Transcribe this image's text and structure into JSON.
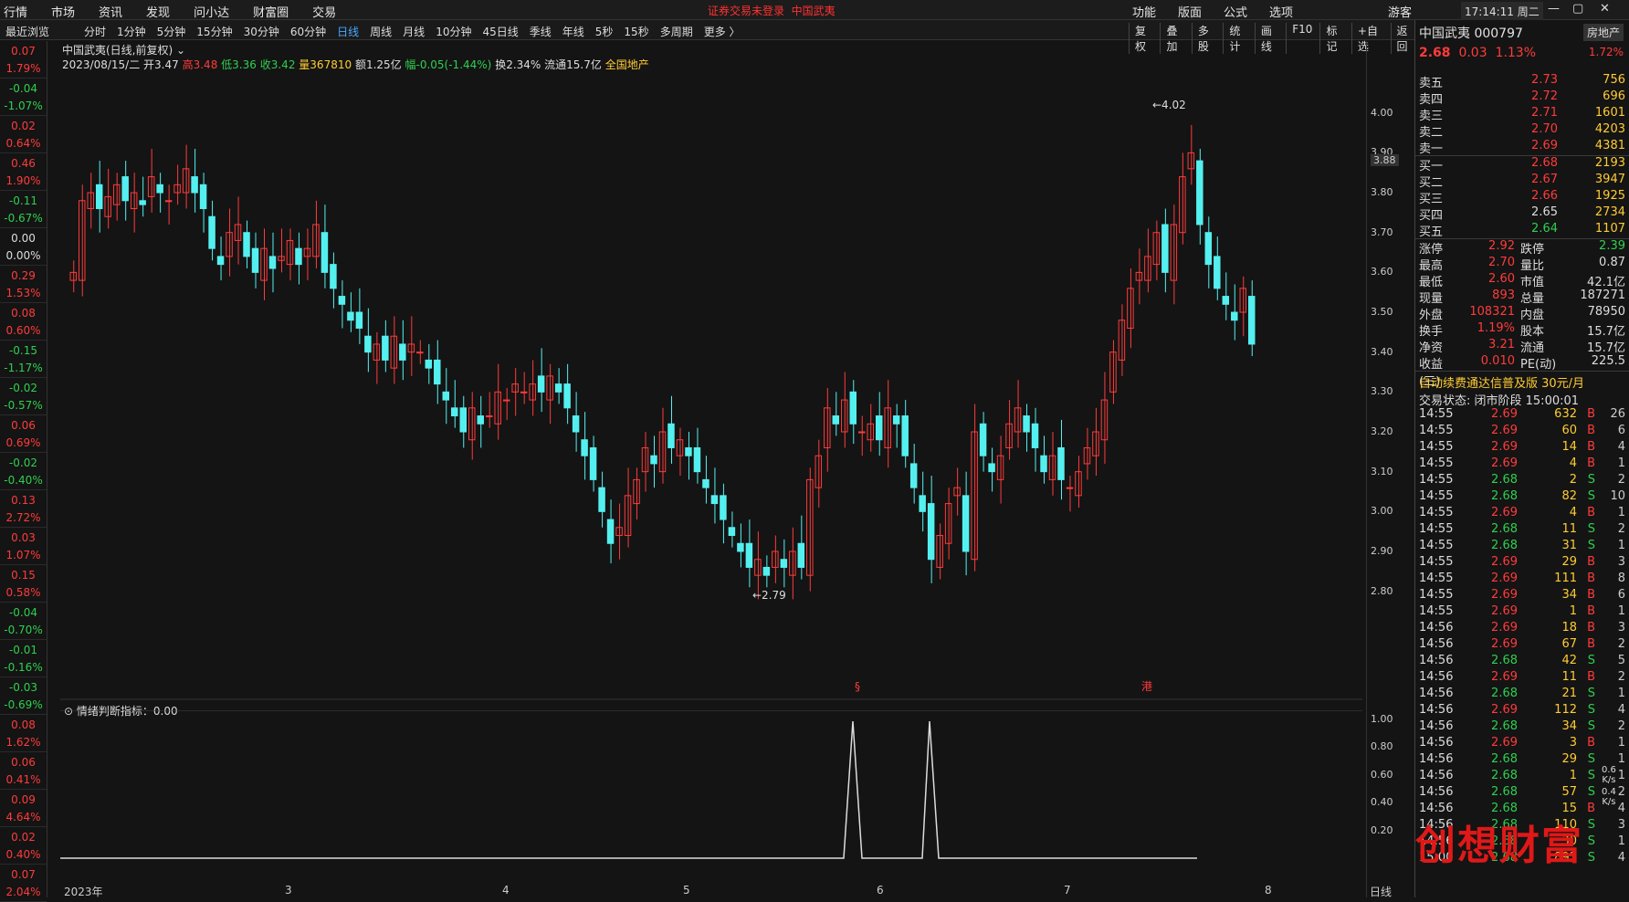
{
  "top": {
    "menu": [
      "行情",
      "市场",
      "资讯",
      "发现",
      "问小达",
      "财富圈",
      "交易"
    ],
    "warning": "证券交易未登录",
    "warning_name": "中国武夷",
    "rmenu": [
      "功能",
      "版面",
      "公式",
      "选项"
    ],
    "guest": "游客",
    "clock": "17:14:11 周二"
  },
  "bar2": {
    "recent": "最近浏览",
    "periods": [
      "分时",
      "1分钟",
      "5分钟",
      "15分钟",
      "30分钟",
      "60分钟",
      "日线",
      "周线",
      "月线",
      "10分钟",
      "45日线",
      "季线",
      "年线",
      "5秒",
      "15秒",
      "多周期",
      "更多 〉"
    ],
    "tools": [
      "复权",
      "叠加",
      "多股",
      "统计",
      "画线",
      "F10",
      "标记",
      "+自选",
      "返回"
    ]
  },
  "left_list": [
    [
      "0.07",
      "1.79%",
      "up"
    ],
    [
      "-0.04",
      "-1.07%",
      "dn"
    ],
    [
      "0.02",
      "0.64%",
      "up"
    ],
    [
      "0.46",
      "1.90%",
      "up"
    ],
    [
      "-0.11",
      "-0.67%",
      "dn"
    ],
    [
      "0.00",
      "0.00%",
      "fl"
    ],
    [
      "0.29",
      "1.53%",
      "up"
    ],
    [
      "0.08",
      "0.60%",
      "up"
    ],
    [
      "-0.15",
      "-1.17%",
      "dn"
    ],
    [
      "-0.02",
      "-0.57%",
      "dn"
    ],
    [
      "0.06",
      "0.69%",
      "up"
    ],
    [
      "-0.02",
      "-0.40%",
      "dn"
    ],
    [
      "0.13",
      "2.72%",
      "up"
    ],
    [
      "0.03",
      "1.07%",
      "up"
    ],
    [
      "0.15",
      "0.58%",
      "up"
    ],
    [
      "-0.04",
      "-0.70%",
      "dn"
    ],
    [
      "-0.01",
      "-0.16%",
      "dn"
    ],
    [
      "-0.03",
      "-0.69%",
      "dn"
    ],
    [
      "0.08",
      "1.62%",
      "up"
    ],
    [
      "0.06",
      "0.41%",
      "up"
    ],
    [
      "0.09",
      "4.64%",
      "up"
    ],
    [
      "0.02",
      "0.40%",
      "up"
    ],
    [
      "0.07",
      "2.04%",
      "up"
    ]
  ],
  "chart": {
    "title": "中国武夷(日线,前复权)",
    "date": "2023/08/15/二",
    "open": "开3.47",
    "high": "高3.48",
    "low": "低3.36",
    "close": "收3.42",
    "vol": "量367810",
    "amt": "额1.25亿",
    "chg": "幅-0.05(-1.44%)",
    "turn": "换2.34%",
    "float": "流通15.7亿",
    "sector": "全国地产",
    "hi_label": "4.02",
    "lo_label": "2.79",
    "price_tag": "3.88",
    "ind_title": "情绪判断指标：0.00",
    "xlabels": [
      "2023年",
      "3",
      "4",
      "5",
      "6",
      "7",
      "8"
    ],
    "dayline": "日线",
    "marker1": "§",
    "marker2": "港"
  },
  "yticks": [
    "4.00",
    "3.90",
    "3.80",
    "3.70",
    "3.60",
    "3.50",
    "3.40",
    "3.30",
    "3.20",
    "3.10",
    "3.00",
    "2.90",
    "2.80"
  ],
  "ind_ticks": [
    "1.00",
    "0.80",
    "0.60",
    "0.40",
    "0.20"
  ],
  "quote": {
    "name": "中国武夷",
    "code": "000797",
    "price": "2.68",
    "chg": "0.03",
    "pct": "1.13%",
    "sector": "房地产",
    "sector_pct": "1.72%"
  },
  "asks": [
    [
      "卖五",
      "2.73",
      "756"
    ],
    [
      "卖四",
      "2.72",
      "696"
    ],
    [
      "卖三",
      "2.71",
      "1601"
    ],
    [
      "卖二",
      "2.70",
      "4203"
    ],
    [
      "卖一",
      "2.69",
      "4381"
    ]
  ],
  "bids": [
    [
      "买一",
      "2.68",
      "2193"
    ],
    [
      "买二",
      "2.67",
      "3947"
    ],
    [
      "买三",
      "2.66",
      "1925"
    ],
    [
      "买四",
      "2.65",
      "2734"
    ],
    [
      "买五",
      "2.64",
      "1107"
    ]
  ],
  "stats": [
    [
      "涨停",
      "2.92",
      "跌停",
      "2.39"
    ],
    [
      "最高",
      "2.70",
      "量比",
      "0.87"
    ],
    [
      "最低",
      "2.60",
      "市值",
      "42.1亿"
    ],
    [
      "现量",
      "893",
      "总量",
      "187271"
    ],
    [
      "外盘",
      "108321",
      "内盘",
      "78950"
    ],
    [
      "换手",
      "1.19%",
      "股本",
      "15.7亿"
    ],
    [
      "净资",
      "3.21",
      "流通",
      "15.7亿"
    ],
    [
      "收益(三)",
      "0.010",
      "PE(动)",
      "225.5"
    ]
  ],
  "promo": "自动续费通达信普及版  30元/月",
  "trade_state": "交易状态: 闭市阶段 15:00:01",
  "ticks": [
    [
      "14:55",
      "2.69",
      "632",
      "B",
      "26"
    ],
    [
      "14:55",
      "2.69",
      "60",
      "B",
      "6"
    ],
    [
      "14:55",
      "2.69",
      "14",
      "B",
      "4"
    ],
    [
      "14:55",
      "2.69",
      "4",
      "B",
      "1"
    ],
    [
      "14:55",
      "2.68",
      "2",
      "S",
      "2"
    ],
    [
      "14:55",
      "2.68",
      "82",
      "S",
      "10"
    ],
    [
      "14:55",
      "2.69",
      "4",
      "B",
      "1"
    ],
    [
      "14:55",
      "2.68",
      "11",
      "S",
      "2"
    ],
    [
      "14:55",
      "2.68",
      "31",
      "S",
      "1"
    ],
    [
      "14:55",
      "2.69",
      "29",
      "B",
      "3"
    ],
    [
      "14:55",
      "2.69",
      "111",
      "B",
      "8"
    ],
    [
      "14:55",
      "2.69",
      "34",
      "B",
      "6"
    ],
    [
      "14:55",
      "2.69",
      "1",
      "B",
      "1"
    ],
    [
      "14:56",
      "2.69",
      "18",
      "B",
      "3"
    ],
    [
      "14:56",
      "2.69",
      "67",
      "B",
      "2"
    ],
    [
      "14:56",
      "2.68",
      "42",
      "S",
      "5"
    ],
    [
      "14:56",
      "2.69",
      "11",
      "B",
      "2"
    ],
    [
      "14:56",
      "2.68",
      "21",
      "S",
      "1"
    ],
    [
      "14:56",
      "2.69",
      "112",
      "S",
      "4"
    ],
    [
      "14:56",
      "2.68",
      "34",
      "S",
      "2"
    ],
    [
      "14:56",
      "2.69",
      "3",
      "B",
      "1"
    ],
    [
      "14:56",
      "2.68",
      "29",
      "S",
      "1"
    ],
    [
      "14:56",
      "2.68",
      "1",
      "S",
      "1"
    ],
    [
      "14:56",
      "2.68",
      "57",
      "S",
      "2"
    ],
    [
      "14:56",
      "2.68",
      "15",
      "B",
      "4"
    ],
    [
      "14:56",
      "2.68",
      "110",
      "S",
      "3"
    ],
    [
      "14:56",
      "2.68",
      "30",
      "S",
      "1"
    ],
    [
      "15:00",
      "2.68",
      "893",
      "S",
      "4"
    ]
  ],
  "speed": [
    "0.6",
    "K/s",
    "0.4",
    "K/s"
  ],
  "watermark": "创想财富"
}
